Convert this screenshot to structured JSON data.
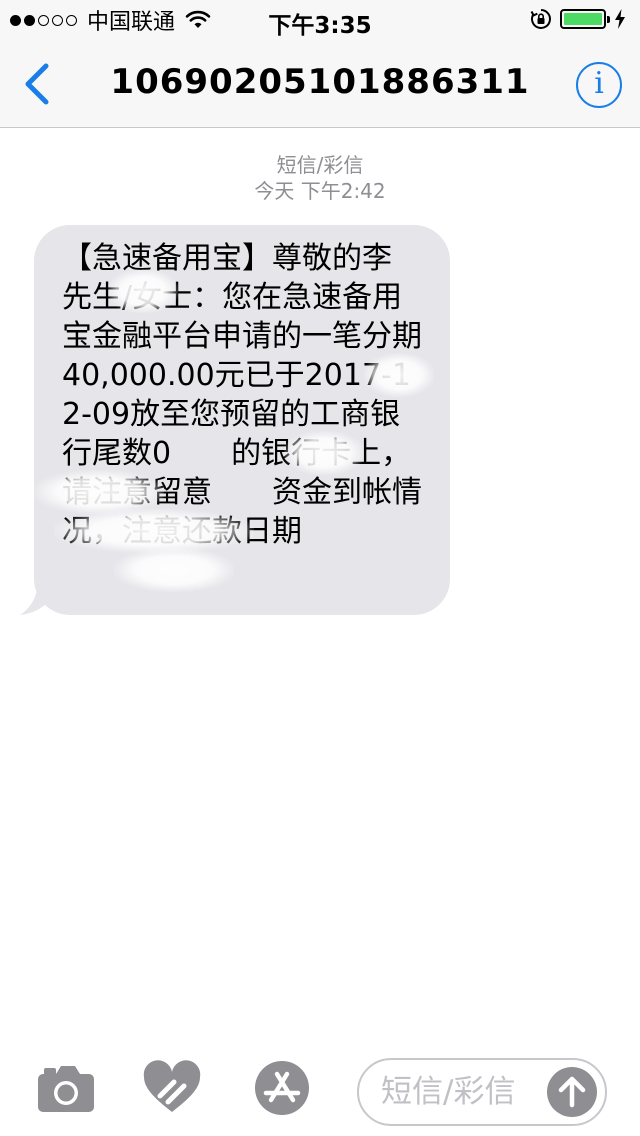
{
  "status_bar": {
    "carrier": "中国联通",
    "time": "下午3:35",
    "signal_bars_filled": 2,
    "signal_bars_total": 5,
    "battery_level": 1.0,
    "battery_color": "#4cd964"
  },
  "nav": {
    "title": "10690205101886311",
    "back_icon": "chevron-left-icon",
    "info_icon": "info-circle-icon",
    "info_glyph": "i",
    "accent_color": "#1a7ee6"
  },
  "meta": {
    "service": "短信/彩信",
    "timestamp": "今天 下午2:42"
  },
  "message": {
    "text": "【急速备用宝】尊敬的李　　先生/女士：您在急速备用宝金融平台申请的一笔分期40,000.00元已于2017-12-09放至您预留的工商银行尾数0　　的银行卡上，请注意留意　　资金到帐情况，注意还款日期",
    "bubble_color": "#e5e5ea"
  },
  "composer": {
    "camera_icon": "camera-icon",
    "digital_touch_icon": "heart-digital-touch-icon",
    "app_store_icon": "app-store-icon",
    "placeholder": "短信/彩信",
    "value": "",
    "send_icon": "arrow-up-icon"
  }
}
